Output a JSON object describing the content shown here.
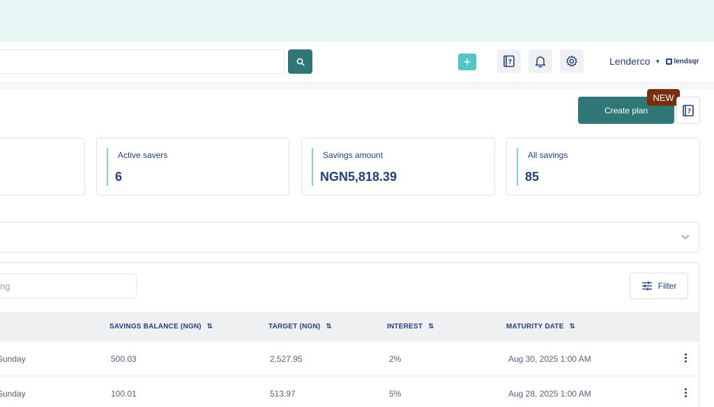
{
  "header": {
    "search_placeholder": "",
    "org_name": "Lenderco",
    "brand": "lendsqr",
    "add_label": "+"
  },
  "toolbar": {
    "create_plan_label": "Create plan",
    "new_badge": "NEW"
  },
  "stats": [
    {
      "label": "Active savers",
      "value": "6"
    },
    {
      "label": "Savings amount",
      "value": "NGN5,818.39"
    },
    {
      "label": "All savings",
      "value": "85"
    }
  ],
  "table": {
    "search_value": "ng",
    "filter_label": "Filter",
    "columns": [
      "SAVINGS BALANCE (NGN)",
      "TARGET (NGN)",
      "INTEREST",
      "MATURITY DATE"
    ],
    "rows": [
      {
        "name": "Sunday",
        "balance": "500.03",
        "target": "2,527.95",
        "interest": "2%",
        "maturity": "Aug 30, 2025 1:00 AM"
      },
      {
        "name": "Sunday",
        "balance": "100.01",
        "target": "513.97",
        "interest": "5%",
        "maturity": "Aug 28, 2025 1:00 AM"
      }
    ]
  },
  "icons": {
    "search": "search-icon",
    "help": "help-book-icon",
    "bell": "bell-icon",
    "settings": "gear-icon",
    "caret": "caret-down-icon",
    "chevron": "chevron-down-icon",
    "filter": "sliders-icon",
    "sort": "sort-icon",
    "more": "kebab-icon"
  },
  "colors": {
    "primary": "#2e7776",
    "accent": "#4ec8c6",
    "text": "#213f7d",
    "badge": "#7a2e0e",
    "banner": "#e9f6f6"
  }
}
